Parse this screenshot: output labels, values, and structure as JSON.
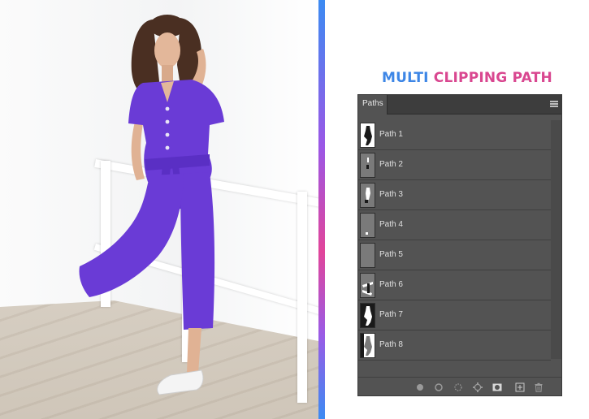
{
  "heading": {
    "word1": "MULTI",
    "word2": "CLIPPING PATH"
  },
  "panel": {
    "tab_label": "Paths",
    "rows": [
      {
        "label": "Path 1"
      },
      {
        "label": "Path 2"
      },
      {
        "label": "Path 3"
      },
      {
        "label": "Path 4"
      },
      {
        "label": "Path 5"
      },
      {
        "label": "Path 6"
      },
      {
        "label": "Path 7"
      },
      {
        "label": "Path 8"
      }
    ],
    "footer_icons": [
      "fill-path-icon",
      "stroke-path-icon",
      "load-as-selection-icon",
      "make-work-path-icon",
      "add-mask-icon",
      "new-path-icon",
      "delete-path-icon"
    ]
  },
  "colors": {
    "heading_blue": "#3d86e6",
    "heading_pink": "#d94790",
    "jumpsuit": "#6a3bd6",
    "panel_bg": "#535353"
  }
}
